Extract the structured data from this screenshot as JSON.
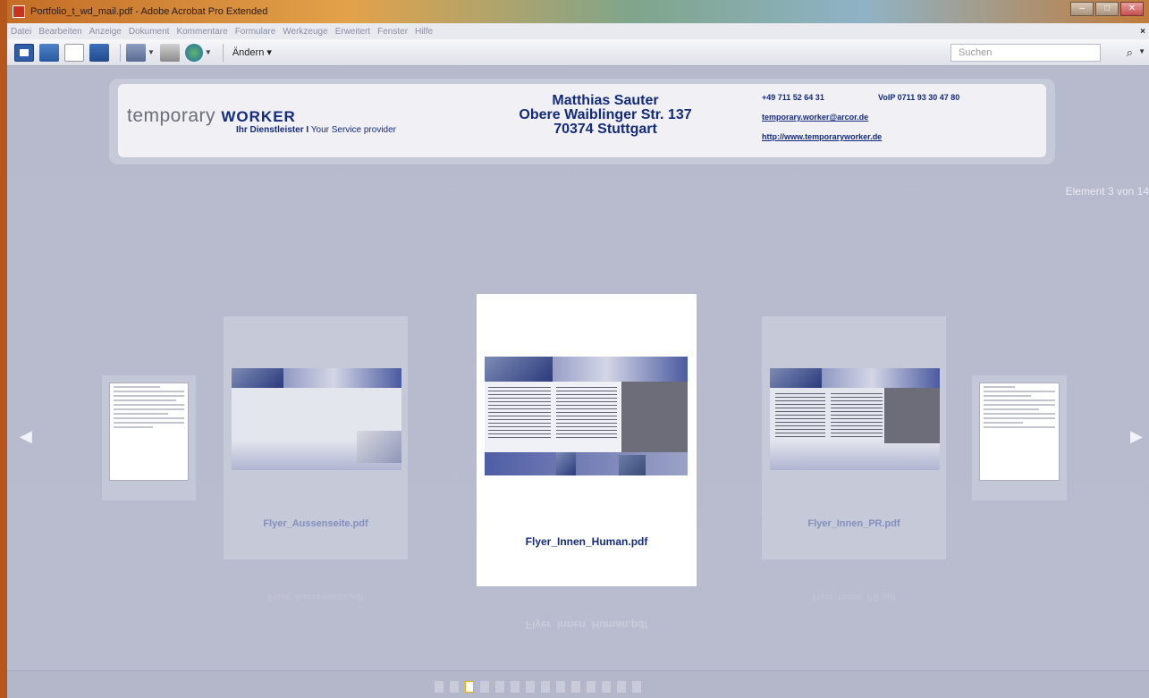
{
  "window": {
    "title": "Portfolio_t_wd_mail.pdf - Adobe Acrobat Pro Extended",
    "min": "–",
    "max": "□",
    "close": "✕"
  },
  "menu": {
    "items": [
      "Datei",
      "Bearbeiten",
      "Anzeige",
      "Dokument",
      "Kommentare",
      "Formulare",
      "Werkzeuge",
      "Erweitert",
      "Fenster",
      "Hilfe"
    ],
    "close": "×"
  },
  "toolbar": {
    "modify_label": "Ändern ▾",
    "search_placeholder": "Suchen"
  },
  "header": {
    "logo_word": "temporary",
    "logo_bold": "WORKER",
    "logo_sub_bold": "Ihr Dienstleister",
    "logo_sep": "I",
    "logo_sub": "Your Service provider",
    "name": "Matthias Sauter",
    "street": "Obere Waiblinger Str. 137",
    "city": "70374 Stuttgart",
    "phone": "+49 711 52 64 31",
    "voip": "VoIP 0711 93 30 47 80",
    "email": "temporary.worker@arcor.de",
    "website": "http://www.temporaryworker.de"
  },
  "carousel": {
    "counter": "Element 3 von 14",
    "items": [
      {
        "label": "Flyer_Aussenseite.pdf"
      },
      {
        "label": "Flyer_Innen_Human.pdf"
      },
      {
        "label": "Flyer_Innen_PR.pdf"
      }
    ],
    "reflection_center": "Flyer_Innen_Human.pdf",
    "reflection_left": "Flyer_Aussenseite.pdf",
    "reflection_right": "Flyer_Innen_PR.pdf",
    "prev": "◀",
    "next": "▶",
    "pages_total": 14,
    "active_page": 3
  }
}
